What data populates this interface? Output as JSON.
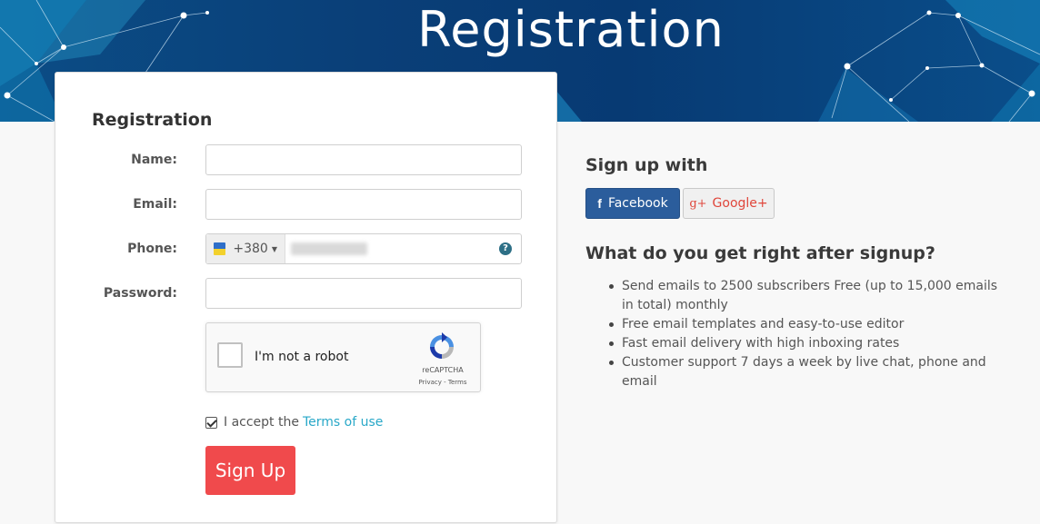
{
  "banner": {
    "title": "Registration"
  },
  "form": {
    "title": "Registration",
    "name_label": "Name:",
    "name_value": "",
    "email_label": "Email:",
    "email_value": "",
    "phone_label": "Phone:",
    "phone_dial_code": "+380",
    "phone_help": "?",
    "password_label": "Password:",
    "password_value": "",
    "captcha": {
      "label": "I'm not a robot",
      "brand": "reCAPTCHA",
      "links": "Privacy - Terms"
    },
    "accept_text": "I accept the",
    "terms_link": "Terms of use",
    "accept_checked": true,
    "submit_label": "Sign Up"
  },
  "social": {
    "title": "Sign up with",
    "facebook_icon": "f",
    "facebook_label": "Facebook",
    "google_icon": "g+",
    "google_label": "Google+"
  },
  "benefits": {
    "title": "What do you get right after signup?",
    "items": [
      "Send emails to 2500 subscribers Free (up to 15,000 emails in total) monthly",
      "Free email templates and easy-to-use editor",
      "Fast email delivery with high inboxing rates",
      "Customer support 7 days a week by live chat, phone and email"
    ]
  },
  "colors": {
    "banner": "#0a3f78",
    "signup_button": "#f04a4c",
    "facebook": "#2b5d9c",
    "google": "#e0463b",
    "link": "#29a8c8"
  }
}
